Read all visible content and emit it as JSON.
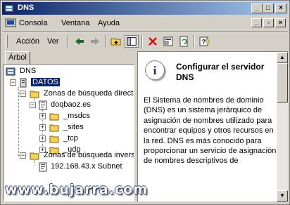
{
  "window": {
    "title": "DNS"
  },
  "menu": {
    "items": [
      "Consola",
      "Ventana",
      "Ayuda"
    ]
  },
  "toolbar": {
    "action_label": "Acción",
    "view_label": "Ver"
  },
  "tabs": {
    "active": "Árbol"
  },
  "tree": {
    "root": "DNS",
    "server": "DATOS",
    "forward_zones": "Zonas de búsqueda directa",
    "domain": "doqbaoz.es",
    "subfolders": [
      "_msdcs",
      "_sites",
      "_tcp",
      "_udp"
    ],
    "reverse_zones": "Zonas de búsqueda inversa",
    "subnet": "192.168.43.x Subnet"
  },
  "details": {
    "title": "Configurar el servidor DNS",
    "body": "El Sistema de nombres de dominio (DNS) es un sistema jerárquico de asignación de nombres utilizado para encontrar equipos y otros recursos en la red. DNS es más conocido para proporcionar un servicio de asignación de nombres descriptivos de",
    "cut_line": "...  DNS ..."
  },
  "watermark": "www.bujarra.com",
  "colors": {
    "title_start": "#0a246a",
    "title_end": "#a6caf0",
    "selection": "#0a246a",
    "chrome": "#d4d0c8"
  }
}
